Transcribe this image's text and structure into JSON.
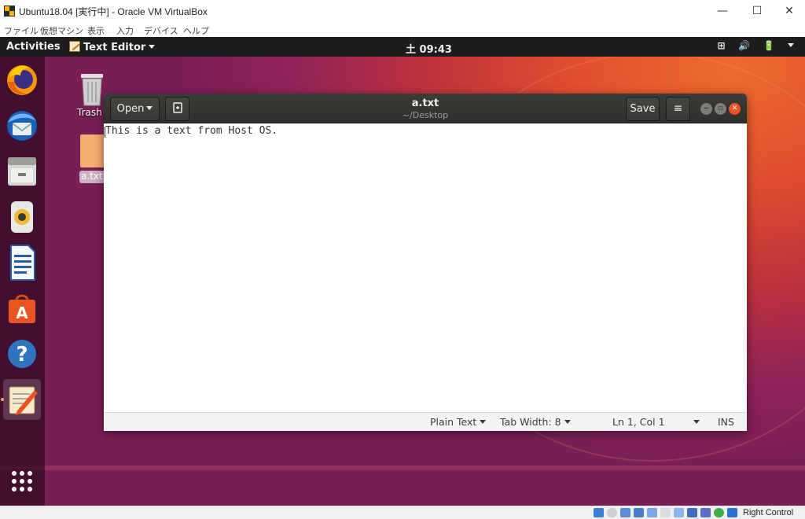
{
  "vbox": {
    "title": "Ubuntu18.04 [実行中] - Oracle VM VirtualBox",
    "controls": {
      "minimize": "—",
      "maximize": "☐",
      "close": "✕"
    },
    "menu": [
      "ファイル",
      "仮想マシン",
      "表示",
      "入力",
      "デバイス",
      "ヘルプ"
    ],
    "host_key": "Right Control",
    "status_icon_names": [
      "hard-disk-icon",
      "optical-drive-icon",
      "audio-icon",
      "network-icon",
      "usb-icon",
      "shared-folders-icon",
      "display-icon",
      "video-capture-icon",
      "virtualization-icon",
      "cpu-icon",
      "mouse-integration-icon",
      "keyboard-icon"
    ]
  },
  "ubuntu": {
    "activities": "Activities",
    "app_menu": "Text Editor",
    "clock": "土 09:43",
    "tray": {
      "network": "⊞",
      "volume": "🔊",
      "power": "🔋"
    },
    "dock": [
      "firefox-icon",
      "thunderbird-icon",
      "files-icon",
      "rhythmbox-icon",
      "libreoffice-writer-icon",
      "software-center-icon",
      "help-icon",
      "text-editor-icon",
      "show-applications-icon"
    ],
    "desktop": {
      "trash_label": "Trash",
      "file_label": "a.txt"
    }
  },
  "gedit": {
    "open_label": "Open",
    "save_label": "Save",
    "menu_glyph": "≡",
    "title": "a.txt",
    "path": "~/Desktop",
    "content": "This is a text from Host OS.",
    "status": {
      "language": "Plain Text",
      "tab_width": "Tab Width: 8",
      "position": "Ln 1, Col 1",
      "mode": "INS"
    }
  },
  "colors": {
    "ubuntu_orange": "#e95420",
    "aubergine": "#77216f",
    "topbar": "#1d1d1d"
  }
}
